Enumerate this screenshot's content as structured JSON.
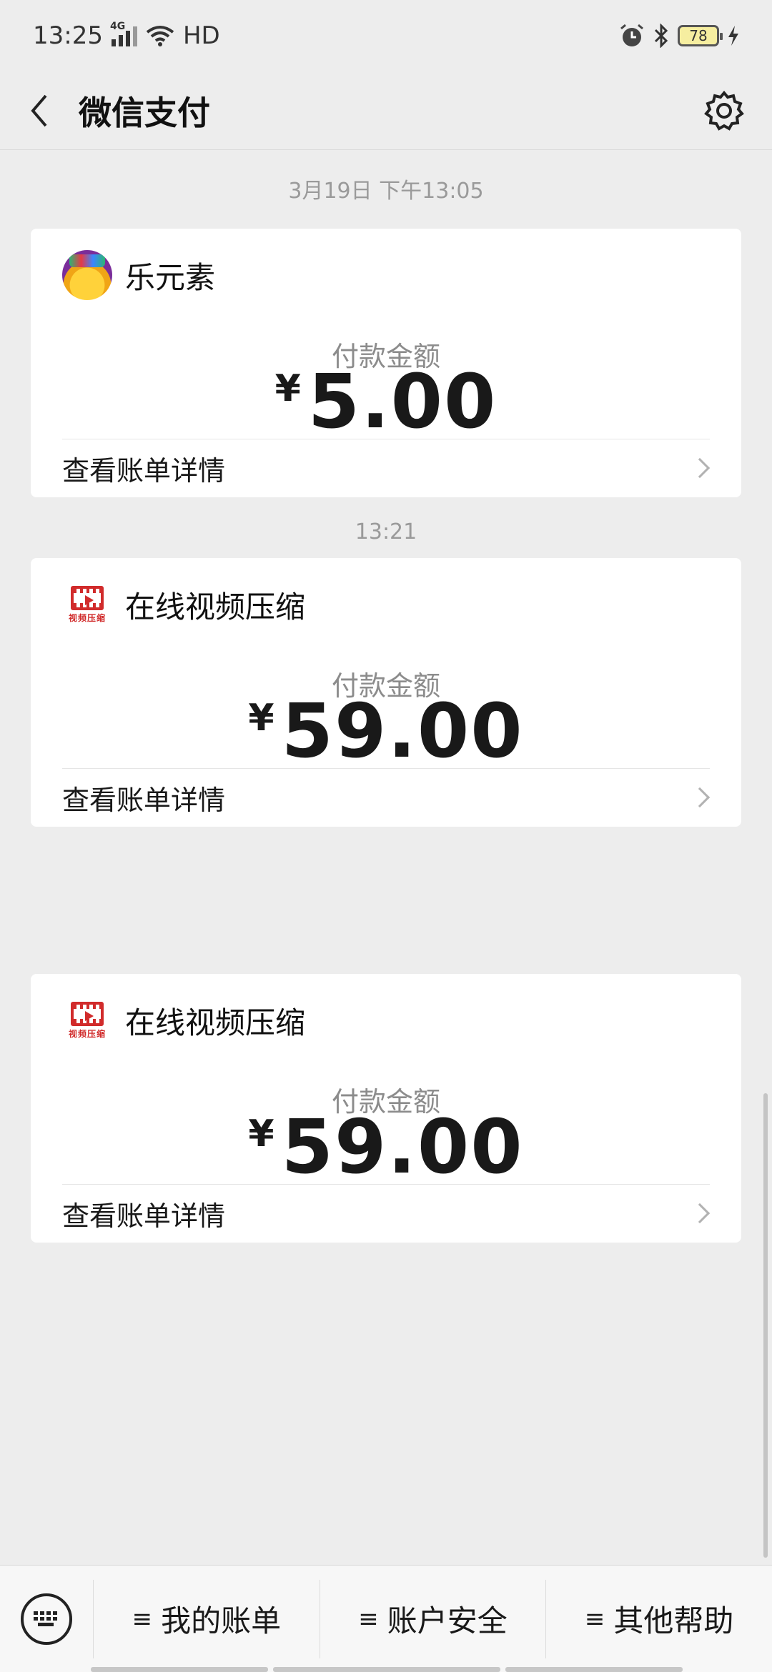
{
  "status_bar": {
    "time": "13:25",
    "network": "4G",
    "wifi_label": "HD",
    "battery": "78"
  },
  "header": {
    "title": "微信支付",
    "back_icon": "chevron-left-icon",
    "settings_icon": "gear-icon"
  },
  "feed": {
    "timestamps": [
      "3月19日 下午13:05",
      "13:21"
    ],
    "messages": [
      {
        "merchant": "乐元素",
        "icon": "game-app-icon",
        "amount_label": "付款金额",
        "currency": "¥",
        "amount": "5.00",
        "detail_label": "查看账单详情"
      },
      {
        "merchant": "在线视频压缩",
        "icon": "video-compress-app-icon",
        "icon_text": "视频压缩",
        "amount_label": "付款金额",
        "currency": "¥",
        "amount": "59.00",
        "detail_label": "查看账单详情"
      },
      {
        "merchant": "在线视频压缩",
        "icon": "video-compress-app-icon",
        "icon_text": "视频压缩",
        "amount_label": "付款金额",
        "currency": "¥",
        "amount": "59.00",
        "detail_label": "查看账单详情"
      }
    ]
  },
  "bottom_menu": {
    "keyboard_icon": "keyboard-icon",
    "items": [
      {
        "glyph": "≡",
        "label": "我的账单"
      },
      {
        "glyph": "≡",
        "label": "账户安全"
      },
      {
        "glyph": "≡",
        "label": "其他帮助"
      }
    ]
  },
  "colors": {
    "background": "#ededed",
    "card": "#ffffff",
    "muted_text": "#9a9a9a",
    "video_icon_red": "#d12b2b"
  }
}
